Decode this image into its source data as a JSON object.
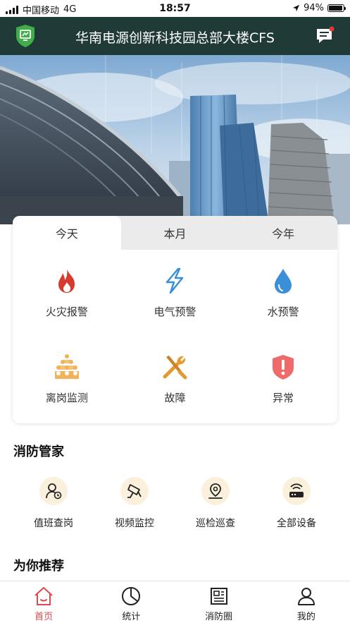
{
  "status_bar": {
    "carrier": "中国移动",
    "network": "4G",
    "time": "18:57",
    "battery_text": "94%",
    "battery_level": 0.94
  },
  "header": {
    "title": "华南电源创新科技园总部大楼CFS",
    "logo_icon": "shield-screen-icon",
    "message_icon": "message-icon",
    "accent_color": "#1f3a37"
  },
  "hero": {
    "image": "city-buildings-photo"
  },
  "tabs": [
    {
      "label": "今天",
      "active": true
    },
    {
      "label": "本月",
      "active": false
    },
    {
      "label": "今年",
      "active": false
    }
  ],
  "alarms": [
    {
      "label": "火灾报警",
      "icon": "fire-icon",
      "color": "#d63b2f"
    },
    {
      "label": "电气预警",
      "icon": "lightning-icon",
      "color": "#3a8fd6"
    },
    {
      "label": "水预警",
      "icon": "water-drop-icon",
      "color": "#3a8fd6"
    },
    {
      "label": "离岗监测",
      "icon": "people-group-icon",
      "color": "#f0b35a"
    },
    {
      "label": "故障",
      "icon": "wrench-screwdriver-icon",
      "color": "#e49a2e"
    },
    {
      "label": "异常",
      "icon": "shield-alert-icon",
      "color": "#ef6b6b"
    }
  ],
  "steward": {
    "title": "消防管家",
    "items": [
      {
        "label": "值班查岗",
        "icon": "user-clock-icon"
      },
      {
        "label": "视频监控",
        "icon": "camera-icon"
      },
      {
        "label": "巡检巡查",
        "icon": "location-pin-icon"
      },
      {
        "label": "全部设备",
        "icon": "router-icon"
      }
    ]
  },
  "recommend": {
    "title": "为你推荐"
  },
  "bottom_nav": [
    {
      "label": "首页",
      "icon": "home-icon",
      "active": true
    },
    {
      "label": "统计",
      "icon": "pie-chart-icon",
      "active": false
    },
    {
      "label": "消防圈",
      "icon": "news-icon",
      "active": false
    },
    {
      "label": "我的",
      "icon": "user-icon",
      "active": false
    }
  ]
}
